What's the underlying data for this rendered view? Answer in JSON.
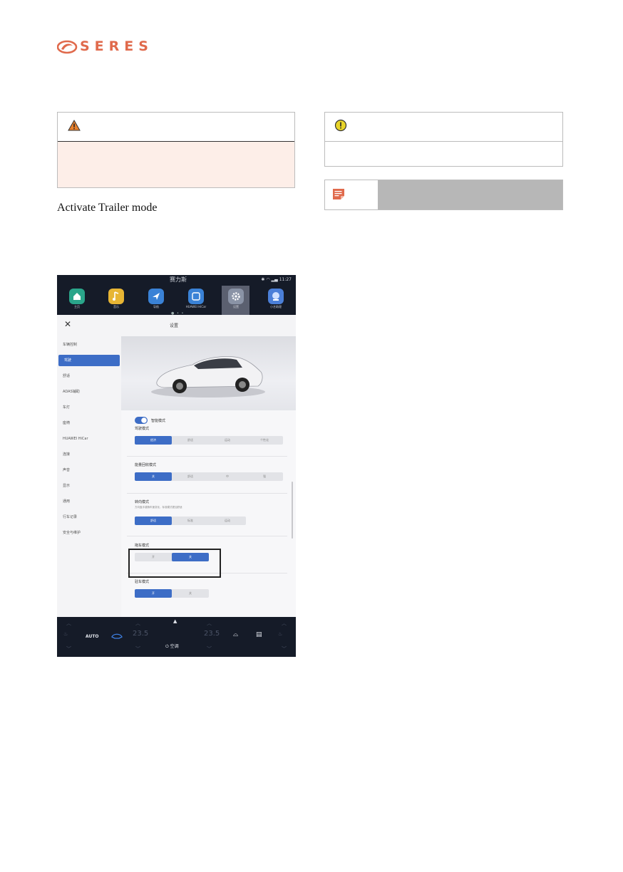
{
  "brand": {
    "name": "SERES",
    "color": "#e06a4c"
  },
  "warning_box": {
    "icon": "warning-triangle-icon",
    "color": "#e8802c"
  },
  "caution_box": {
    "icon": "exclamation-circle-icon",
    "color": "#e8d42a"
  },
  "note_box": {
    "icon": "note-icon",
    "color": "#e06a4c"
  },
  "heading": "Activate Trailer mode",
  "screenshot": {
    "status": {
      "time": "11:27",
      "logo": "赛力斯"
    },
    "apps": [
      {
        "label": "主页",
        "icon": "home-icon",
        "color": "#2aa58a"
      },
      {
        "label": "音乐",
        "icon": "music-icon",
        "color": "#e7b534"
      },
      {
        "label": "导航",
        "icon": "navigation-icon",
        "color": "#3a82d6"
      },
      {
        "label": "HUAWEI HiCar",
        "icon": "hicar-icon",
        "color": "#3a82d6"
      },
      {
        "label": "设置",
        "icon": "settings-icon",
        "color": "#8a93a6"
      },
      {
        "label": "小艺助理",
        "icon": "assistant-icon",
        "color": "#4b7fd8"
      }
    ],
    "panel_title": "设置",
    "sidebar": [
      "车辆控制",
      "驾驶",
      "舒适",
      "ADAS辅助",
      "车灯",
      "座椅",
      "HUAWEI HiCar",
      "连接",
      "声音",
      "显示",
      "通用",
      "行车记录",
      "安全与维护"
    ],
    "sidebar_selected": 1,
    "toggle_label": "智能模式",
    "drive_mode": {
      "label": "驾驶模式",
      "options": [
        "经济",
        "舒适",
        "运动",
        "个性化"
      ],
      "selected": 0
    },
    "regen_mode": {
      "label": "能量回收模式",
      "options": [
        "关",
        "舒适",
        "中",
        "强"
      ],
      "selected": 0
    },
    "steering_mode": {
      "label": "转向模式",
      "note": "方向盘手感随车速变化，标准模式更加舒适",
      "options": [
        "舒适",
        "标准",
        "运动"
      ],
      "selected": 0
    },
    "trailer_mode": {
      "label": "拖车模式",
      "options": [
        "开",
        "关"
      ],
      "selected": 1
    },
    "hold_mode": {
      "label": "驻车模式",
      "options": [
        "开",
        "关"
      ],
      "selected": 0
    },
    "bottom": {
      "auto": "AUTO",
      "temp_left": "23.5",
      "temp_right": "23.5",
      "ac": "空调"
    }
  }
}
